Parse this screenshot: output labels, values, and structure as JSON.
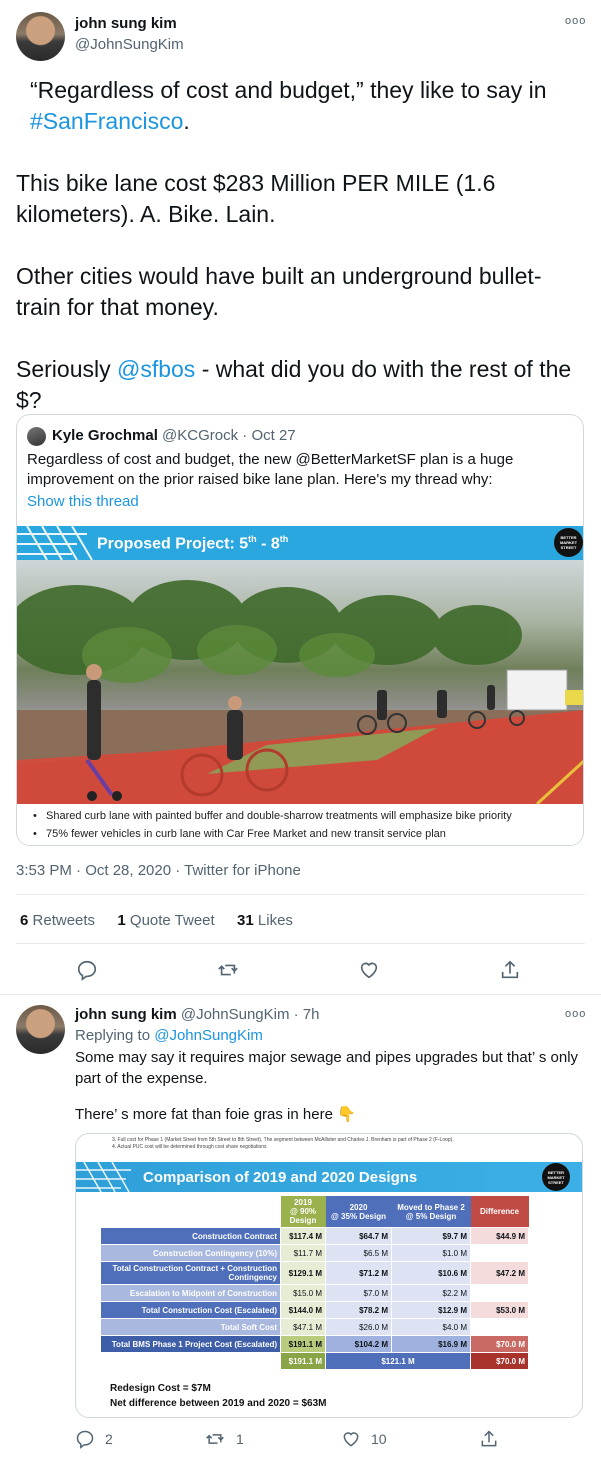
{
  "tweet": {
    "author_name": "john sung kim",
    "author_handle": "@JohnSungKim",
    "more": "ooo",
    "text": {
      "p1a": "“Regardless of cost and budget,” they like to say in ",
      "p1_hashtag": "#SanFrancisco",
      "p1b": ".",
      "p2": "This bike lane cost $283 Million PER MILE (1.6 kilometers). A. Bike. Lain.",
      "p3": "Other cities would have built an underground bullet-train for that money.",
      "p4a": "Seriously ",
      "p4_mention": "@sfbos",
      "p4b": " - what did you do with the rest of the $?"
    },
    "quoted": {
      "author_name": "Kyle Grochmal",
      "author_handle": "@KCGrock",
      "date": "· Oct 27",
      "text": "Regardless of cost and budget, the new @BetterMarketSF plan is a huge improvement on the prior raised bike lane plan. Here's my thread why:",
      "show_thread": "Show this thread",
      "image": {
        "banner_title": "Proposed Project: 5",
        "banner_sup1": "th",
        "banner_mid": " - 8",
        "banner_sup2": "th",
        "logo_text": "BETTER MARKET STREET",
        "bullet1": "Shared curb lane with painted buffer and double-sharrow treatments will emphasize bike priority",
        "bullet2": "75% fewer vehicles in curb lane with Car Free Market and new transit service plan"
      }
    },
    "meta": "3:53 PM · Oct 28, 2020 · Twitter for iPhone",
    "stats": {
      "retweets_count": "6",
      "retweets_label": "Retweets",
      "quotes_count": "1",
      "quotes_label": "Quote Tweet",
      "likes_count": "31",
      "likes_label": "Likes"
    }
  },
  "reply": {
    "author_name": "john sung kim",
    "author_handle": "@JohnSungKim",
    "time": "· 7h",
    "more": "ooo",
    "replying_to_label": "Replying to ",
    "replying_to_handle": "@JohnSungKim",
    "text1": "Some may say it requires major sewage and pipes upgrades but that’ s only part of the expense.",
    "text2": "There’ s more fat than foie gras in here 👇",
    "image": {
      "note3": "3. Full cost for Phase 1 (Market Street from 5th Street to 8th Street). The segment between McAllister and Charles J. Brenham is part of Phase 2 (F-Loop).",
      "note4": "4. Actual PUC cost will be determined through cost share negotiations",
      "title": "Comparison of 2019 and 2020 Designs",
      "logo_text": "BETTER MARKET STREET",
      "col_2019a": "2019",
      "col_2019b": "@ 90% Design",
      "col_2020a": "2020",
      "col_2020b": "@ 35% Design",
      "col_movea": "Moved to Phase 2",
      "col_moveb": "@ 5% Design",
      "col_diff": "Difference",
      "rows": [
        {
          "label": "Construction Contract",
          "v2019": "$117.4 M",
          "v2020": "$64.7 M",
          "move": "$9.7 M",
          "diff": "$44.9 M"
        },
        {
          "label": "Construction Contingency (10%)",
          "v2019": "$11.7 M",
          "v2020": "$6.5 M",
          "move": "$1.0 M",
          "diff": ""
        },
        {
          "label": "Total Construction Contract + Construction Contingency",
          "v2019": "$129.1 M",
          "v2020": "$71.2 M",
          "move": "$10.6 M",
          "diff": "$47.2 M"
        },
        {
          "label": "Escalation to Midpoint of Construction",
          "v2019": "$15.0 M",
          "v2020": "$7.0 M",
          "move": "$2.2 M",
          "diff": ""
        },
        {
          "label": "Total Construction Cost (Escalated)",
          "v2019": "$144.0 M",
          "v2020": "$78.2 M",
          "move": "$12.9 M",
          "diff": "$53.0 M"
        },
        {
          "label": "Total Soft Cost",
          "v2019": "$47.1 M",
          "v2020": "$26.0 M",
          "move": "$4.0 M",
          "diff": ""
        },
        {
          "label": "Total BMS Phase 1 Project Cost (Escalated)",
          "v2019": "$191.1 M",
          "v2020": "$104.2 M",
          "move": "$16.9 M",
          "diff": "$70.0 M"
        }
      ],
      "sum_2019": "$191.1 M",
      "sum_2020": "$121.1 M",
      "sum_diff": "$70.0 M",
      "redesign": "Redesign Cost = $7M",
      "netdiff": "Net difference between 2019 and 2020 = $63M"
    },
    "replies_count": "2",
    "retweets_count": "1",
    "likes_count": "10"
  }
}
